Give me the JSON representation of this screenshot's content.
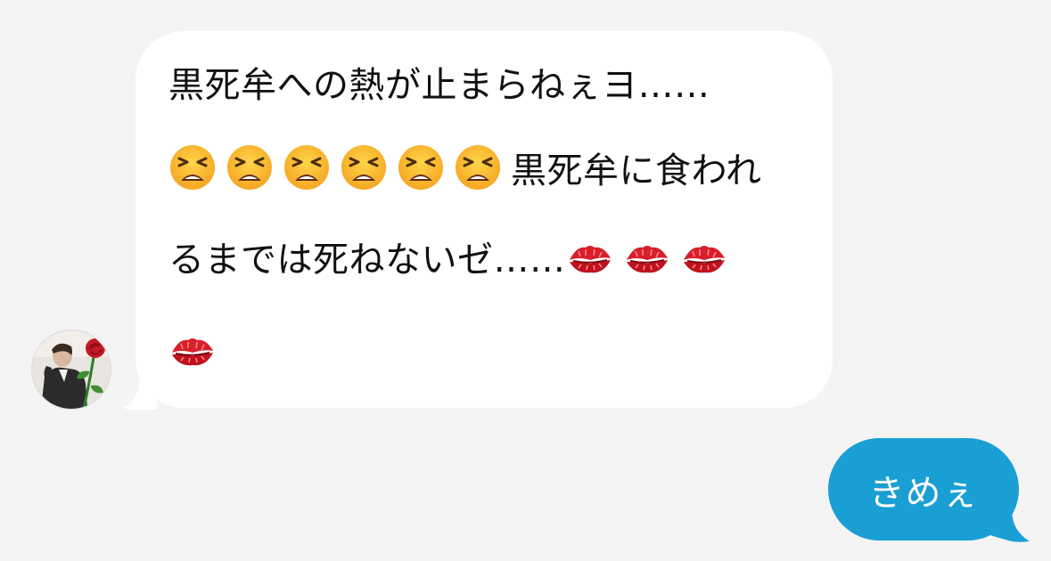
{
  "conversation": {
    "incoming": {
      "sender_avatar": "avatar-man-with-rose",
      "line1": "黒死牟への熱が止まらねぇヨ……",
      "line2_emojis": [
        "tired-face-emoji",
        "tired-face-emoji",
        "tired-face-emoji",
        "tired-face-emoji",
        "tired-face-emoji",
        "tired-face-emoji"
      ],
      "line2_text": "黒死牟に食われ",
      "line3_text": "るまでは死ねないゼ……",
      "line3_emojis": [
        "kiss-mark-emoji",
        "kiss-mark-emoji",
        "kiss-mark-emoji"
      ],
      "line4_emojis": [
        "kiss-mark-emoji"
      ]
    },
    "outgoing": {
      "text": "きめぇ"
    }
  },
  "colors": {
    "background": "#f4f4f4",
    "incoming_bubble": "#ffffff",
    "outgoing_bubble": "#1a9fd4",
    "text_dark": "#111111",
    "text_light": "#ffffff"
  }
}
